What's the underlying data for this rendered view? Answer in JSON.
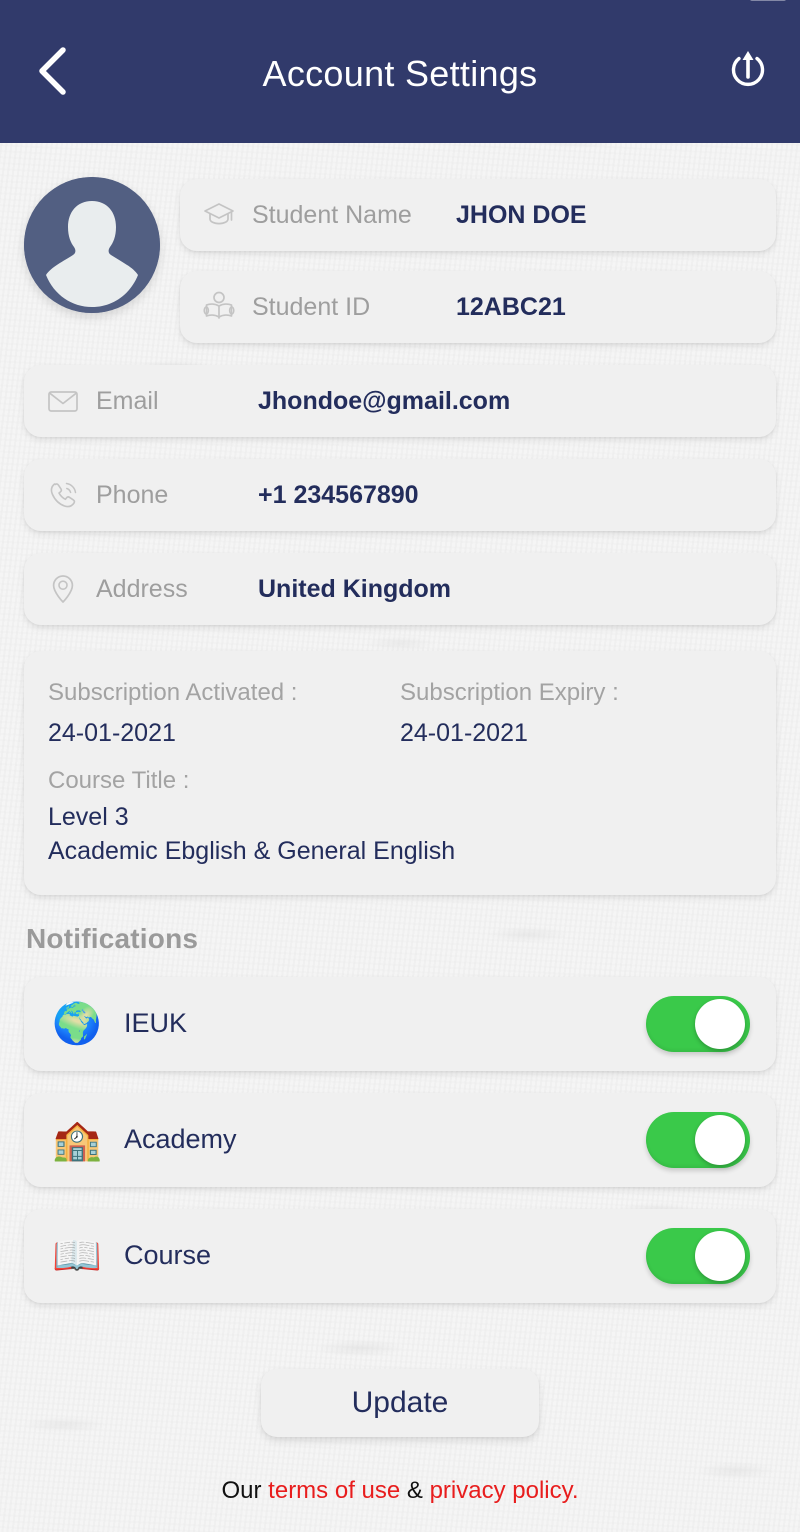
{
  "statusbar": {
    "left_text": "",
    "right_text": ""
  },
  "header": {
    "title": "Account Settings",
    "back_icon": "chevron-left-icon",
    "power_icon": "power-logout-icon"
  },
  "profile": {
    "avatar_icon": "user-avatar-placeholder",
    "avatar_bg": "#525f82",
    "fields": [
      {
        "icon": "graduation-cap-icon",
        "label": "Student Name",
        "value": "JHON DOE"
      },
      {
        "icon": "student-reading-icon",
        "label": "Student ID",
        "value": "12ABC21"
      }
    ]
  },
  "contact": {
    "fields": [
      {
        "icon": "envelope-icon",
        "label": "Email",
        "value": "Jhondoe@gmail.com"
      },
      {
        "icon": "phone-icon",
        "label": "Phone",
        "value": "+1 234567890"
      },
      {
        "icon": "location-pin-icon",
        "label": "Address",
        "value": "United Kingdom"
      }
    ]
  },
  "subscription": {
    "activated_label": "Subscription Activated :",
    "activated_value": "24-01-2021",
    "expiry_label": "Subscription Expiry :",
    "expiry_value": "24-01-2021",
    "course_label": "Course Title :",
    "course_level": "Level 3",
    "course_name": "Academic Ebglish & General English"
  },
  "notifications": {
    "title": "Notifications",
    "accent_on_color": "#3ac94a",
    "items": [
      {
        "icon": "globe-icon",
        "emoji": "🌍",
        "label": "IEUK",
        "enabled": true
      },
      {
        "icon": "school-building-icon",
        "emoji": "🏫",
        "label": "Academy",
        "enabled": true
      },
      {
        "icon": "open-book-icon",
        "emoji": "📖",
        "label": "Course",
        "enabled": true
      }
    ]
  },
  "footer": {
    "update_label": "Update",
    "legal_prefix": "Our ",
    "terms_label": "terms of use",
    "legal_separator": " & ",
    "privacy_label": "privacy policy.",
    "link_color": "#e81d1d"
  }
}
